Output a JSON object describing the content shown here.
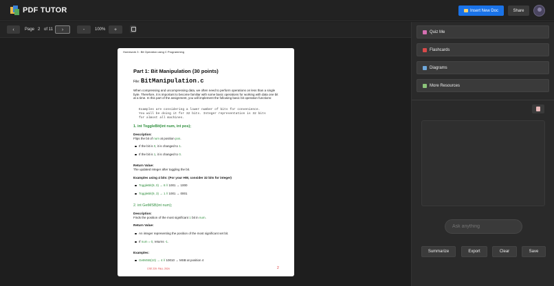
{
  "app": {
    "title": "PDF TUTOR"
  },
  "header": {
    "insert_label": "Insert New Doc",
    "share_label": "Share"
  },
  "toolbar": {
    "prev": "‹",
    "next": "›",
    "page_label": "Page",
    "page_current": "2",
    "page_total": "of 11",
    "zoom_out": "-",
    "zoom": "100%",
    "zoom_in": "+"
  },
  "document": {
    "header": "Homework 3 : Bit Operation using C Programming",
    "part_title": "Part 1: Bit Manipulation  (30 points)",
    "file_label": "File: ",
    "file_name": "BitManipulation.c",
    "intro": "When compressing and uncompressing data, we often need to perform operations on less than a single byte. Therefore, it is important to become familiar with some basic operations for working with data one bit at a time. In this part of the assignment, you will implement the following basic bit operation functions:",
    "code": [
      "Examples are considering a lower number of bits for convenience.",
      "You will be doing it for 32 bits. Integer representation is 32 bits",
      "for almost all machines."
    ],
    "f1_title": "1. int ToggleBit(int num, int pos);",
    "desc_label": "Description:",
    "f1_desc_a": "Flips the bit of ",
    "num_word": "num",
    "f1_desc_b": " at position ",
    "pos_word": "pos",
    "f1_desc_c": ".",
    "f1_b1_a": "If the bit is ",
    "f1_b1_zero": "0",
    "f1_b1_b": ", it is changed to ",
    "f1_b1_one": "1",
    "f1_b1_c": ".",
    "f1_b2_a": "If the bit is ",
    "f1_b2_one": "1",
    "f1_b2_b": ", it is changed to ",
    "f1_b2_zero": "0",
    "f1_b2_c": ".",
    "ret_label": "Return Value:",
    "f1_ret": "The updated integer after toggling the bit.",
    "ex4_label": "Examples using 4 bits: (For your HW, consider 32 bits for integer)",
    "ex1_code": "ToggleBit(9, 0) → 8 //",
    "ex1_rest": " 1001 → 1000",
    "ex2_code": "ToggleBit(9, 3) → 1 //",
    "ex2_rest": " 1001 → 0001",
    "f2_title": "2. int GetMSB(int num);",
    "f2_desc_a": "Finds the position of the most significant ",
    "one_word": "1",
    "f2_desc_b": " bit in ",
    "f2_desc_c": ".",
    "f2_ret_b1": "An integer representing the position of the most significant set bit.",
    "f2_ret_b2_a": "If ",
    "f2_ret_b2_code": "num = 0",
    "f2_ret_b2_b": ", returns ",
    "f2_ret_b2_val": "-1",
    "f2_ret_b2_c": ".",
    "examples_label": "Examples:",
    "ex3_code": "GetMSB(10) → 4 //",
    "ex3_rest": " 10010 → MSB at position 4",
    "footer": "CSE 220: FALL 2024",
    "page_number": "2"
  },
  "sidebar": {
    "menu": [
      {
        "label": "Quiz Me",
        "icon": "quiz-icon",
        "color": "#d56fb1"
      },
      {
        "label": "Flashcards",
        "icon": "flashcards-icon",
        "color": "#d94a4a"
      },
      {
        "label": "Diagrams",
        "icon": "diagrams-icon",
        "color": "#6fa8dc"
      },
      {
        "label": "More Resources",
        "icon": "resources-icon",
        "color": "#8bc47a"
      }
    ],
    "ask_placeholder": "Ask anything",
    "actions": [
      "Summarize",
      "Export",
      "Clear",
      "Save"
    ]
  },
  "colors": {
    "accent": "#1a73e8",
    "code_green": "#2f8f3d"
  }
}
